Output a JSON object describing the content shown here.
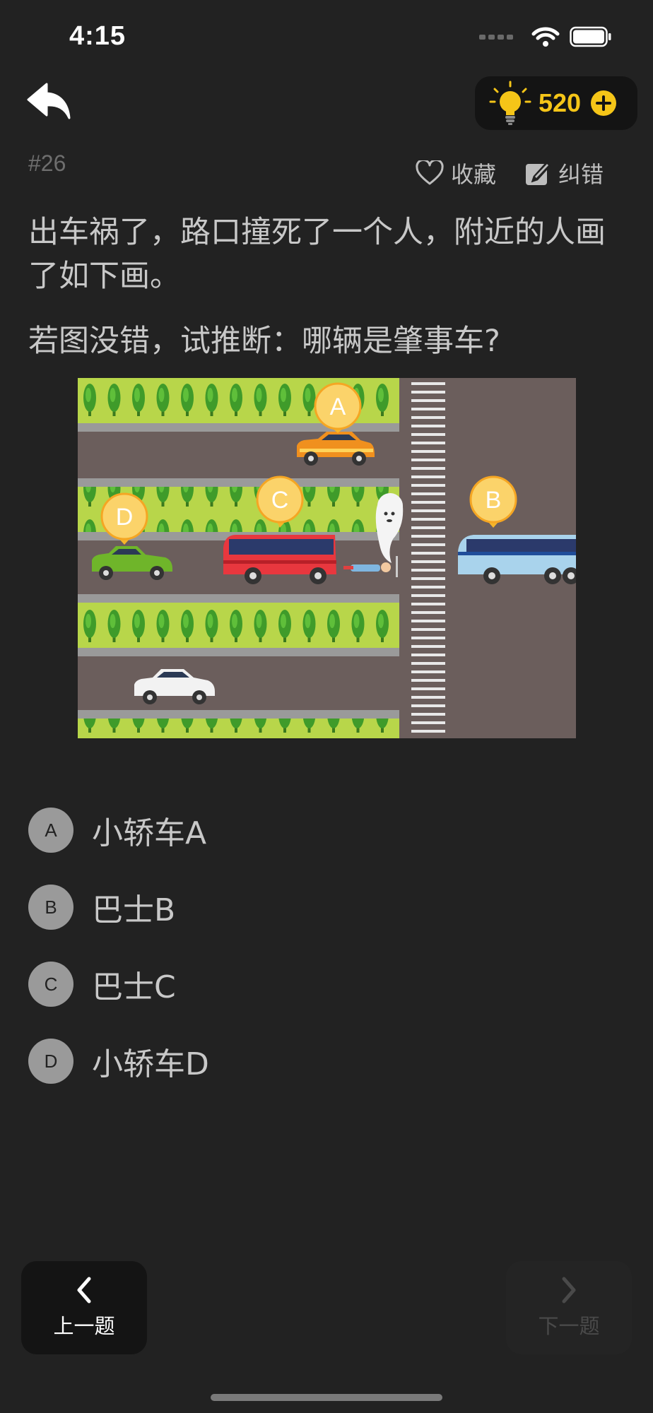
{
  "status_bar": {
    "time": "4:15"
  },
  "header": {
    "hint_count": "520"
  },
  "question": {
    "number": "#26",
    "favorite_label": "收藏",
    "report_label": "纠错",
    "line1": "出车祸了，路口撞死了一个人，附近的人画了如下画。",
    "line2": "若图没错，试推断：哪辆是肇事车?"
  },
  "puzzle_markers": [
    "A",
    "B",
    "C",
    "D"
  ],
  "options": [
    {
      "letter": "A",
      "text": "小轿车A"
    },
    {
      "letter": "B",
      "text": "巴士B"
    },
    {
      "letter": "C",
      "text": "巴士C"
    },
    {
      "letter": "D",
      "text": "小轿车D"
    }
  ],
  "nav": {
    "prev_label": "上一题",
    "next_label": "下一题"
  },
  "colors": {
    "background": "#222222",
    "accent_gold": "#f5c518",
    "text_primary": "#c8c8c8",
    "text_muted": "#6e6e6e"
  }
}
